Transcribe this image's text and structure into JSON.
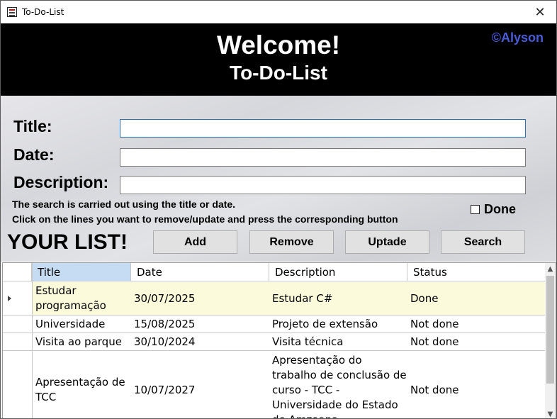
{
  "window": {
    "title": "To-Do-List",
    "close_glyph": "✕"
  },
  "header": {
    "welcome": "Welcome!",
    "subtitle": "To-Do-List",
    "copyright": "©Alyson"
  },
  "form": {
    "title_label": "Title:",
    "date_label": "Date:",
    "description_label": "Description:",
    "title_value": "",
    "date_value": "",
    "description_value": "",
    "hint_line1": "The search is carried out using the title or date.",
    "hint_line2": "Click on the lines you want to remove/update and press the corresponding button",
    "done_label": "Done",
    "done_checked": false
  },
  "list_heading": "YOUR LIST!",
  "buttons": {
    "add": "Add",
    "remove": "Remove",
    "update": "Uptade",
    "search": "Search"
  },
  "grid": {
    "columns": [
      "Title",
      "Date",
      "Description",
      "Status"
    ],
    "rows": [
      {
        "title": "Estudar programação",
        "date": "30/07/2025",
        "description": "Estudar C#",
        "status": "Done"
      },
      {
        "title": "Universidade",
        "date": "15/08/2025",
        "description": "Projeto de extensão",
        "status": "Not done"
      },
      {
        "title": "Visita ao parque",
        "date": "30/10/2024",
        "description": "Visita técnica",
        "status": "Not done"
      },
      {
        "title": "Apresentação de TCC",
        "date": "10/07/2027",
        "description": "Apresentação do trabalho de conclusão de curso - TCC - Universidade do Estado de Amzoans",
        "status": "Not done"
      }
    ]
  },
  "colors": {
    "header_bg": "#000000",
    "copyright": "#4a5bd6",
    "selected_row": "#fbfbdc",
    "selected_header": "#c5dcf2"
  }
}
